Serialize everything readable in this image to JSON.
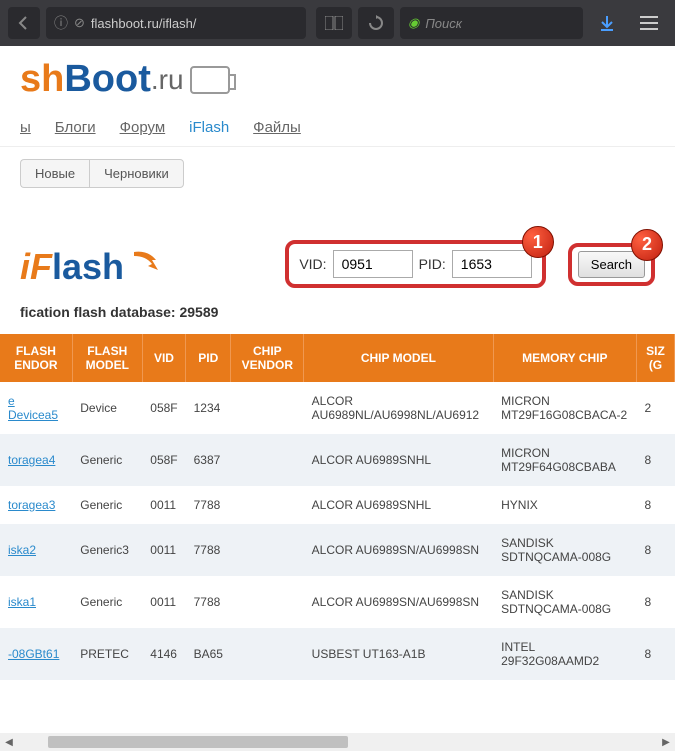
{
  "browser": {
    "url": "flashboot.ru/iflash/",
    "search_placeholder": "Поиск"
  },
  "logo": {
    "part1": "sh",
    "part2": "Boot",
    "part3": ".ru"
  },
  "nav": {
    "items": [
      {
        "label": "ы"
      },
      {
        "label": "Блоги"
      },
      {
        "label": "Форум"
      },
      {
        "label": "iFlash"
      },
      {
        "label": "Файлы"
      }
    ]
  },
  "subnav": {
    "new": "Новые",
    "drafts": "Черновики"
  },
  "iflash": {
    "f": "F",
    "text": "lash"
  },
  "form": {
    "vid_label": "VID:",
    "vid_value": "0951",
    "pid_label": "PID:",
    "pid_value": "1653",
    "search_label": "Search"
  },
  "callouts": {
    "one": "1",
    "two": "2"
  },
  "db_text": "fication flash database: 29589",
  "table": {
    "headers": [
      "FLASH ENDOR",
      "FLASH MODEL",
      "VID",
      "PID",
      "CHIP VENDOR",
      "CHIP MODEL",
      "MEMORY CHIP",
      "SIZ (G"
    ],
    "rows": [
      {
        "link": "e Devicea5",
        "model": "Device",
        "vid": "058F",
        "pid": "1234",
        "cvendor": "",
        "cmodel": "ALCOR AU6989NL/AU6998NL/AU6912",
        "chip": "MICRON MT29F16G08CBACA-2",
        "size": "2"
      },
      {
        "link": "toragea4",
        "model": "Generic",
        "vid": "058F",
        "pid": "6387",
        "cvendor": "",
        "cmodel": "ALCOR AU6989SNHL",
        "chip": "MICRON MT29F64G08CBABA",
        "size": "8"
      },
      {
        "link": "toragea3",
        "model": "Generic",
        "vid": "0011",
        "pid": "7788",
        "cvendor": "",
        "cmodel": "ALCOR AU6989SNHL",
        "chip": "HYNIX",
        "size": "8"
      },
      {
        "link": "iska2",
        "model": "Generic3",
        "vid": "0011",
        "pid": "7788",
        "cvendor": "",
        "cmodel": "ALCOR AU6989SN/AU6998SN",
        "chip": "SANDISK SDTNQCAMA-008G",
        "size": "8"
      },
      {
        "link": "iska1",
        "model": "Generic",
        "vid": "0011",
        "pid": "7788",
        "cvendor": "",
        "cmodel": "ALCOR AU6989SN/AU6998SN",
        "chip": "SANDISK SDTNQCAMA-008G",
        "size": "8"
      },
      {
        "link": "-08GBt61",
        "model": "PRETEC",
        "vid": "4146",
        "pid": "BA65",
        "cvendor": "",
        "cmodel": "USBEST UT163-A1B",
        "chip": "INTEL 29F32G08AAMD2",
        "size": "8"
      }
    ]
  }
}
